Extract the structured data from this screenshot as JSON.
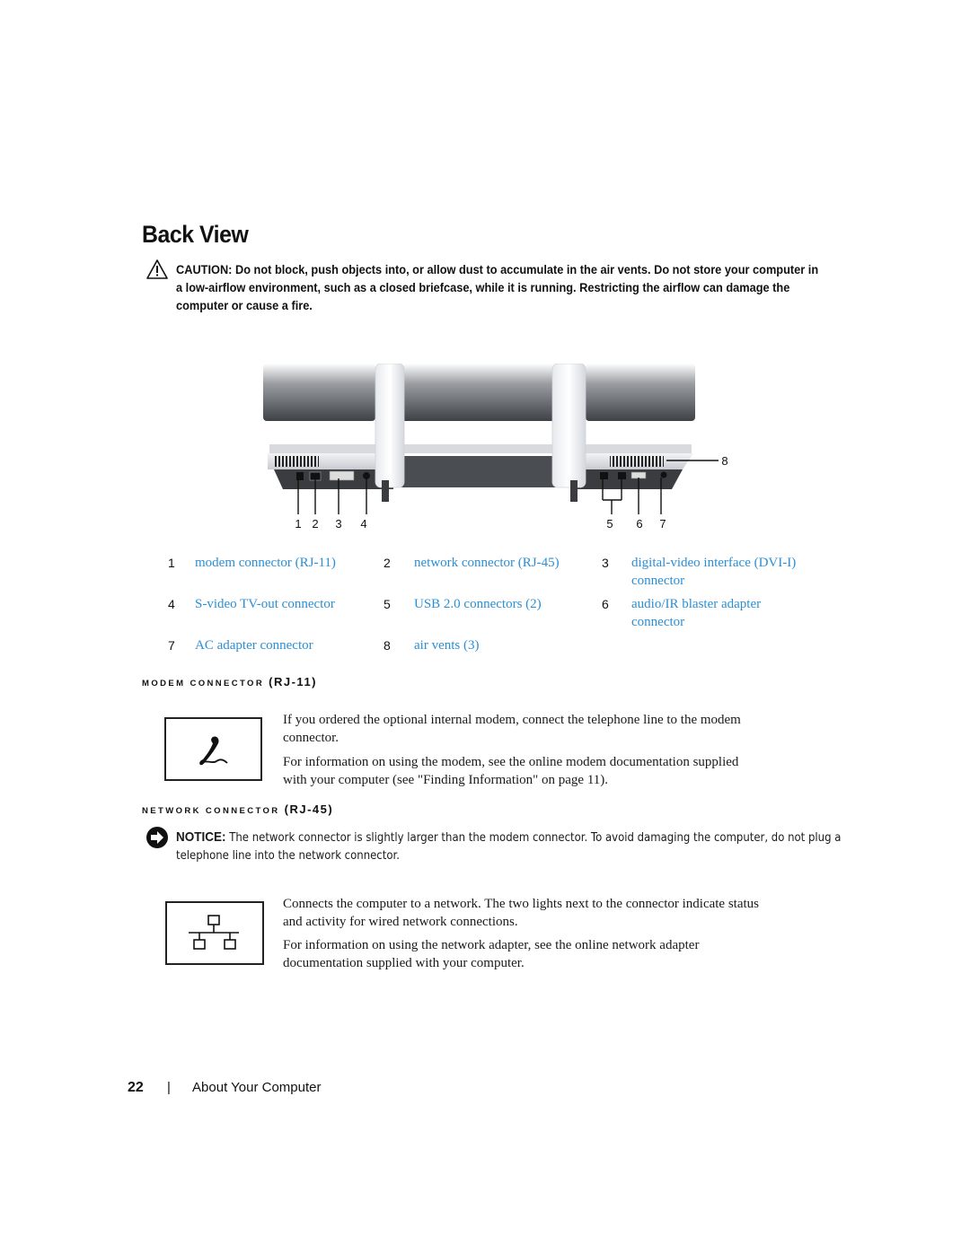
{
  "page": {
    "title": "Back View",
    "caution": {
      "label": "CAUTION:",
      "text": "Do not block, push objects into, or allow dust to accumulate in the air vents. Do not store your computer in a low-airflow environment, such as a closed briefcase, while it is running. Restricting the airflow can damage the computer or cause a fire."
    },
    "figure": {
      "callouts": [
        "1",
        "2",
        "3",
        "4",
        "5",
        "6",
        "7",
        "8"
      ]
    },
    "legend": [
      {
        "num": "1",
        "label": "modem connector (RJ-11)"
      },
      {
        "num": "2",
        "label": "network connector (RJ-45)"
      },
      {
        "num": "3",
        "label": "digital-video interface (DVI-I) connector"
      },
      {
        "num": "4",
        "label": "S-video TV-out connector"
      },
      {
        "num": "5",
        "label": "USB 2.0 connectors (2)"
      },
      {
        "num": "6",
        "label": "audio/IR blaster adapter connector"
      },
      {
        "num": "7",
        "label": "AC adapter connector"
      },
      {
        "num": "8",
        "label": "air vents (3)"
      }
    ],
    "link_color": "#2a8fd6",
    "modem_section": {
      "heading_small": "MODEM CONNECTOR",
      "heading_big": "(RJ-11)",
      "icon": "telephone-icon",
      "paragraphs": [
        "If you ordered the optional internal modem, connect the telephone line to the modem connector.",
        "For information on using the modem, see the online modem documentation supplied with your computer (see \"Finding Information\" on page 11)."
      ]
    },
    "network_section": {
      "heading_small": "NETWORK CONNECTOR",
      "heading_big": "(RJ-45)",
      "notice": {
        "label": "NOTICE:",
        "text": "The network connector is slightly larger than the modem connector. To avoid damaging the computer, do not plug a telephone line into the network connector."
      },
      "icon": "network-icon",
      "paragraphs": [
        "Connects the computer to a network. The two lights next to the connector indicate status and activity for wired network connections.",
        "For information on using the network adapter, see the online network adapter documentation supplied with your computer."
      ]
    },
    "footer": {
      "page_number": "22",
      "separator": "|",
      "section": "About Your Computer"
    }
  }
}
